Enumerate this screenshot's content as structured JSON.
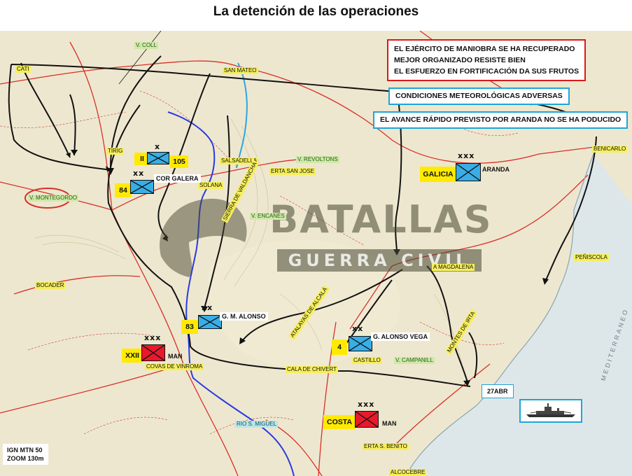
{
  "title": "La detención de las operaciones",
  "notes": {
    "red": [
      "EL EJÉRCITO DE MANIOBRA SE HA RECUPERADO",
      "MEJOR ORGANIZADO RESISTE BIEN",
      "EL ESFUERZO EN FORTIFICACIÓN DA SUS FRUTOS"
    ],
    "weather": "CONDICIONES METEOROLÓGICAS ADVERSAS",
    "advance": "EL AVANCE RÁPIDO PREVISTO POR ARANDA NO SE HA PODUCIDO"
  },
  "places": {
    "v_coll": "V. COLL",
    "cati": "CATI",
    "san_mateo": "SAN MATEO",
    "tirig": "TIRIG",
    "salsadella": "SALSADELLA",
    "v_revoltons": "V. REVOLTONS",
    "erta_san_jose": "ERTA SAN JOSE",
    "solana": "SOLANA",
    "v_montegordo": "V. MONTEGORDO",
    "v_encanes": "V. ENCANES",
    "benicarlo": "BENICARLO",
    "peniscola": "PEÑISCOLA",
    "magdalena": "A MAGDALENA",
    "bocader": "BOCADER",
    "covas": "COVAS DE VINROMA",
    "cala_chivert": "CALA DE CHIVERT",
    "castillo": "CASTILLO",
    "v_campanill": "V. CAMPANILL",
    "rio_san_miguel": "RIO S. MIGUEL",
    "erta_s_benito": "ERTA S. BENITO",
    "alcocebre": "ALCOCEBRE",
    "sierra_valdancha": "SIERRA DE VALDANCHA",
    "atalayas": "ATALAYAS DE ALCALÁ",
    "montes_irta": "MONTES DE IRTA",
    "mediterraneo": "MEDITERRANEO"
  },
  "units": {
    "u105": {
      "echelon": "x",
      "designator": "II",
      "number": "105"
    },
    "u84": {
      "echelon": "xx",
      "number": "84",
      "name": "COR GALERA"
    },
    "galicia": {
      "echelon": "xxx",
      "name": "GALICIA",
      "extra": "ARANDA"
    },
    "u83": {
      "echelon": "xx",
      "number": "83",
      "name": "G. M. ALONSO"
    },
    "xxii": {
      "echelon": "xxx",
      "name": "XXII",
      "extra": "MAN"
    },
    "u4": {
      "echelon": "xx",
      "number": "4",
      "name": "G. ALONSO VEGA"
    },
    "costa": {
      "echelon": "xxx",
      "name": "COSTA",
      "extra": "MAN"
    }
  },
  "date_label": "27ABR",
  "watermark": {
    "main": "BATALLAS",
    "sub": "GUERRA CIVIL"
  },
  "map_source": [
    "IGN MTN 50",
    "ZOOM 130m"
  ],
  "colors": {
    "nationalist": "#39aee6",
    "republican": "#e8192c",
    "highlight": "#ffea00",
    "note_red": "#d91a1a",
    "note_blue": "#1fa5d6"
  },
  "icons": {
    "ship": "warship-icon"
  }
}
